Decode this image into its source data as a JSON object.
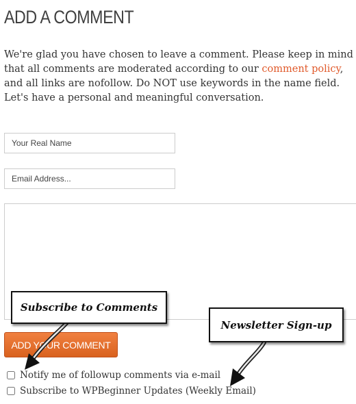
{
  "section": {
    "title": "ADD A COMMENT"
  },
  "intro": {
    "before_link": "We're glad you have chosen to leave a comment. Please keep in mind that all comments are moderated according to our ",
    "link_text": "comment policy",
    "after_link": ", and all links are nofollow. Do NOT use keywords in the name field. Let's have a personal and meaningful conversation."
  },
  "form": {
    "name_placeholder": "Your Real Name",
    "email_placeholder": "Email Address...",
    "submit_label": "Add Your Comment",
    "options": [
      {
        "label": "Notify me of followup comments via e-mail",
        "checked": false
      },
      {
        "label": "Subscribe to WPBeginner Updates (Weekly Email)",
        "checked": false
      }
    ]
  },
  "annotations": [
    {
      "label": "Subscribe to Comments"
    },
    {
      "label": "Newsletter Sign-up"
    }
  ],
  "colors": {
    "accent": "#e0592a",
    "button": "#e46a2a"
  }
}
